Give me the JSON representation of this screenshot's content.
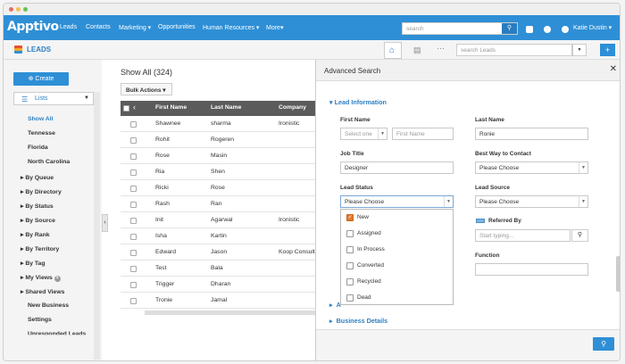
{
  "nav": {
    "logo": "Apptivo",
    "items": [
      "Leads",
      "Contacts",
      "Marketing ▾",
      "Opportunities",
      "Human Resources ▾",
      "More▾"
    ],
    "search_placeholder": "search",
    "user": "Katie Dustin ▾"
  },
  "subbar": {
    "title": "LEADS",
    "search_placeholder": "search Leads"
  },
  "sidebar": {
    "create": "Create",
    "lists": "Lists",
    "sub_items": [
      "Show All",
      "Tennesse",
      "Florida",
      "North Carolina"
    ],
    "groups": [
      "By Queue",
      "By Directory",
      "By Status",
      "By Source",
      "By Rank",
      "By Territory",
      "By Tag",
      "My Views",
      "Shared Views"
    ],
    "extra": [
      "New Business",
      "Settings",
      "Unresponded Leads"
    ]
  },
  "main": {
    "title": "Show All  (324)",
    "bulk": "Bulk Actions ▾",
    "columns": [
      "First Name",
      "Last Name",
      "Company"
    ],
    "rows": [
      [
        "Shawnee",
        "sharma",
        "Ironistic"
      ],
      [
        "Rohit",
        "Rogeren",
        ""
      ],
      [
        "Rose",
        "Masin",
        ""
      ],
      [
        "Ria",
        "Shen",
        ""
      ],
      [
        "Ricki",
        "Rose",
        ""
      ],
      [
        "Rash",
        "Ran",
        ""
      ],
      [
        "Init",
        "Agarwal",
        "Ironistic"
      ],
      [
        "Isha",
        "Kartin",
        ""
      ],
      [
        "Edward",
        "Jason",
        "Koop Consult"
      ],
      [
        "Test",
        "Bala",
        ""
      ],
      [
        "Trigger",
        "Dharan",
        ""
      ],
      [
        "Tronie",
        "Jamal",
        ""
      ]
    ]
  },
  "panel": {
    "title": "Advanced Search",
    "section1": "Lead Information",
    "first_name": "First Name",
    "select_one": "Select one",
    "first_name_ph": "First Name",
    "last_name": "Last Name",
    "last_name_value": "Ronie",
    "job_title": "Job Title",
    "job_title_value": "Designer",
    "best_way": "Best Way to Contact",
    "please_choose": "Please Choose",
    "lead_status": "Lead Status",
    "lead_source": "Lead Source",
    "referred_by": "Referred By",
    "referred_ph": "Start typing...",
    "function": "Function",
    "status_options": [
      "New",
      "Assigned",
      "In Process",
      "Converted",
      "Recycled",
      "Dead"
    ],
    "section_a": "A",
    "section2": "Business Details"
  }
}
